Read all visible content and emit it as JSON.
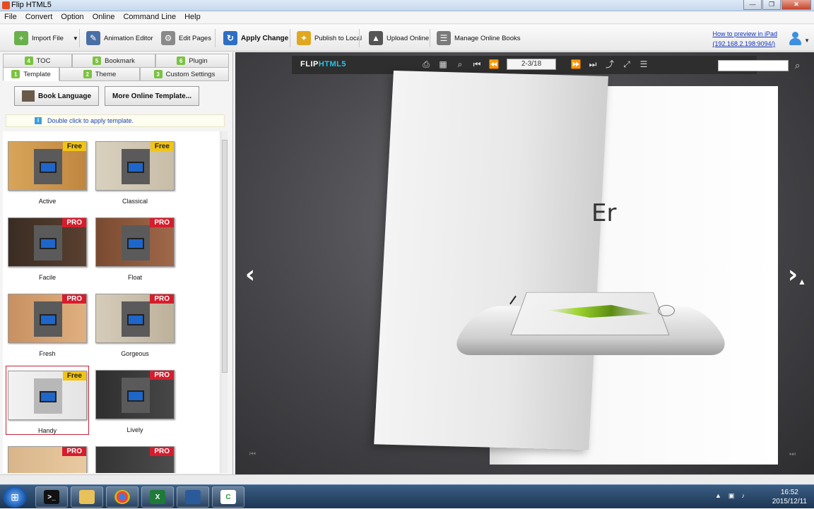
{
  "window": {
    "title": "Flip HTML5",
    "buttons": [
      "—",
      "❐",
      "✕"
    ]
  },
  "menu": [
    "File",
    "Convert",
    "Option",
    "Online",
    "Command Line",
    "Help"
  ],
  "toolbar": {
    "import": "Import File",
    "animation": "Animation Editor",
    "edit": "Edit Pages",
    "apply": "Apply Change",
    "publish": "Publish to Local",
    "upload": "Upload Online",
    "manage": "Manage Online Books",
    "ipad_link_1": "How to preview in iPad",
    "ipad_link_2": "(192.168.2.198:9094/)"
  },
  "panel": {
    "tabs_top": [
      {
        "num": "4",
        "label": "TOC"
      },
      {
        "num": "5",
        "label": "Bookmark"
      },
      {
        "num": "6",
        "label": "Plugin"
      }
    ],
    "tabs_bottom": [
      {
        "num": "1",
        "label": "Template"
      },
      {
        "num": "2",
        "label": "Theme"
      },
      {
        "num": "3",
        "label": "Custom Settings"
      }
    ],
    "book_language": "Book Language",
    "more_templates": "More Online Template...",
    "hint": "Double click to apply template.",
    "templates": [
      {
        "name": "Active",
        "badge": "Free"
      },
      {
        "name": "Classical",
        "badge": "Free"
      },
      {
        "name": "Facile",
        "badge": "PRO"
      },
      {
        "name": "Float",
        "badge": "PRO"
      },
      {
        "name": "Fresh",
        "badge": "PRO"
      },
      {
        "name": "Gorgeous",
        "badge": "PRO"
      },
      {
        "name": "Handy",
        "badge": "Free"
      },
      {
        "name": "Lively",
        "badge": "PRO"
      },
      {
        "name": "",
        "badge": "PRO"
      },
      {
        "name": "",
        "badge": "PRO"
      }
    ]
  },
  "viewer": {
    "logo_a": "FLIP",
    "logo_b": "HTML5",
    "page_indicator": "2-3/18",
    "page_text": "Er",
    "prev_arrow": "‹",
    "next_arrow": "›"
  },
  "taskbar": {
    "time": "16:52",
    "date": "2015/12/11"
  }
}
